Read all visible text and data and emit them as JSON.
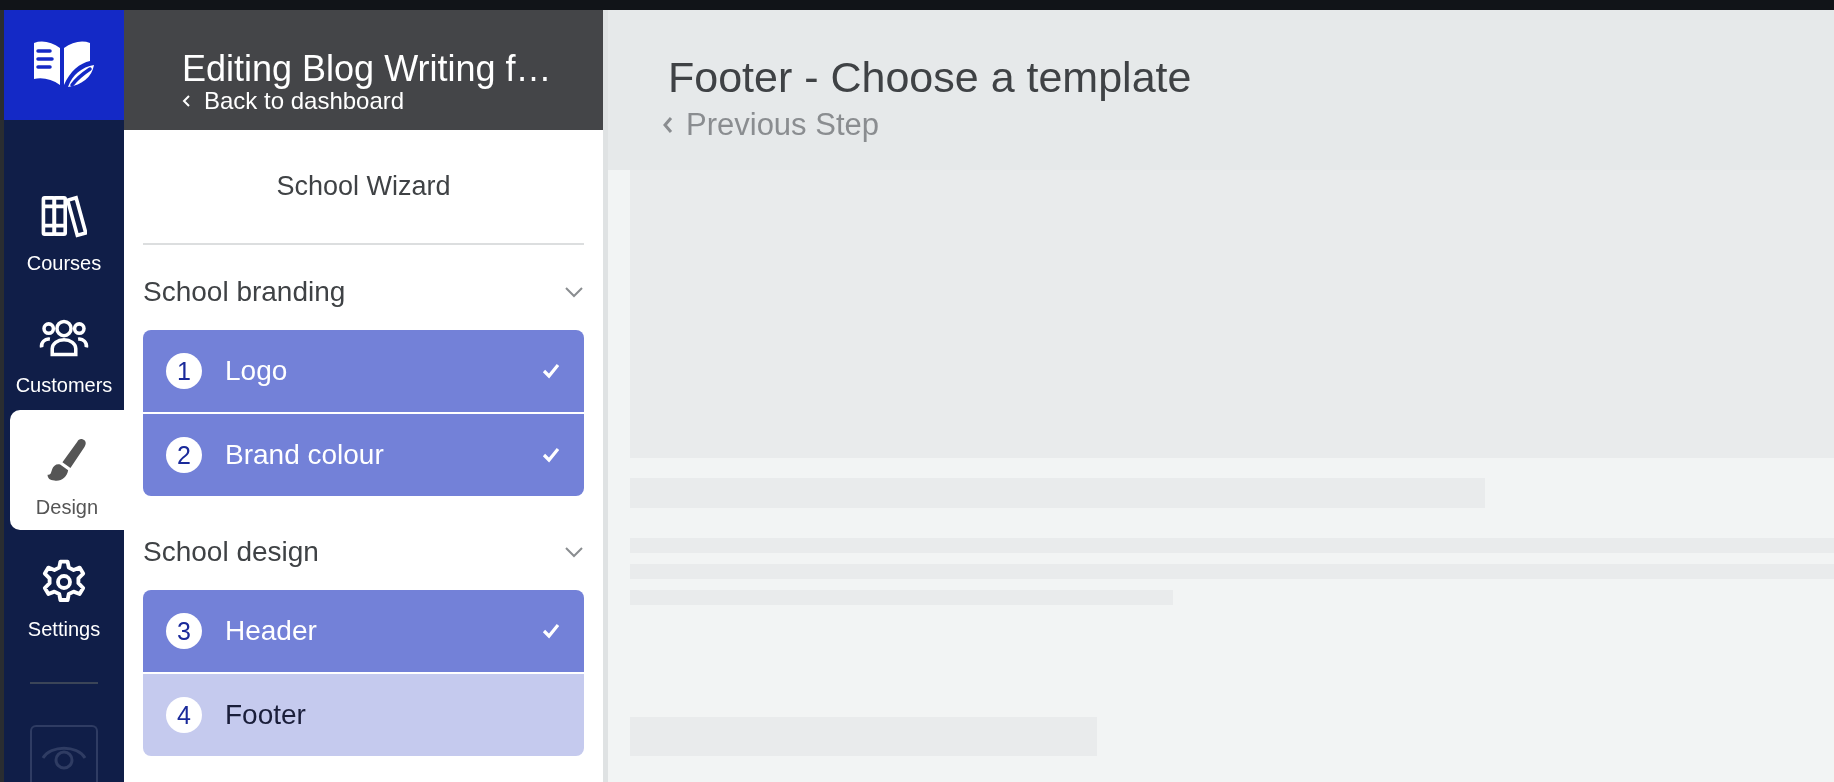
{
  "nav": {
    "items": [
      {
        "label": "Courses",
        "selected": false
      },
      {
        "label": "Customers",
        "selected": false
      },
      {
        "label": "Design",
        "selected": true
      },
      {
        "label": "Settings",
        "selected": false
      }
    ]
  },
  "sidebar": {
    "title": "Editing Blog Writing f…",
    "back_link": "Back to dashboard",
    "wizard_title": "School Wizard",
    "sections": [
      {
        "title": "School branding",
        "expanded": true,
        "steps": [
          {
            "number": "1",
            "label": "Logo",
            "completed": true,
            "selected": false
          },
          {
            "number": "2",
            "label": "Brand colour",
            "completed": true,
            "selected": false
          }
        ]
      },
      {
        "title": "School design",
        "expanded": true,
        "steps": [
          {
            "number": "3",
            "label": "Header",
            "completed": true,
            "selected": false
          },
          {
            "number": "4",
            "label": "Footer",
            "completed": false,
            "selected": true
          }
        ]
      }
    ]
  },
  "main": {
    "title": "Footer - Choose a template",
    "back_link": "Previous Step"
  }
}
